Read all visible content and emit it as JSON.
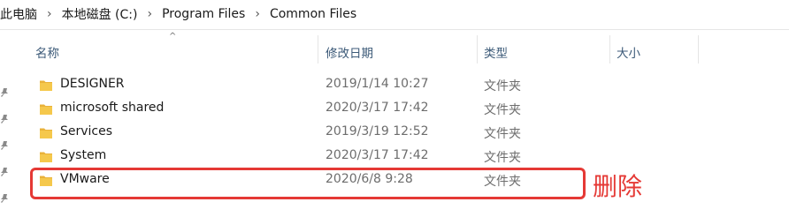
{
  "breadcrumb": [
    "此电脑",
    "本地磁盘 (C:)",
    "Program Files",
    "Common Files"
  ],
  "columns": {
    "name": "名称",
    "date": "修改日期",
    "type": "类型",
    "size": "大小"
  },
  "rows": [
    {
      "name": "DESIGNER",
      "date": "2019/1/14 10:27",
      "type": "文件夹",
      "size": ""
    },
    {
      "name": "microsoft shared",
      "date": "2020/3/17 17:42",
      "type": "文件夹",
      "size": ""
    },
    {
      "name": "Services",
      "date": "2019/3/19 12:52",
      "type": "文件夹",
      "size": ""
    },
    {
      "name": "System",
      "date": "2020/3/17 17:42",
      "type": "文件夹",
      "size": ""
    },
    {
      "name": "VMware",
      "date": "2020/6/8 9:28",
      "type": "文件夹",
      "size": ""
    }
  ],
  "annotation": {
    "label": "删除",
    "color": "#e53935"
  },
  "icons": {
    "folder": "folder-icon",
    "pin": "pin-icon",
    "chevron": "chevron-right-icon",
    "sort": "sort-ascending-icon"
  },
  "colors": {
    "folder_yellow": "#f2c94c",
    "header_text": "#3c5a78",
    "secondary_text": "#6d6d6d"
  }
}
